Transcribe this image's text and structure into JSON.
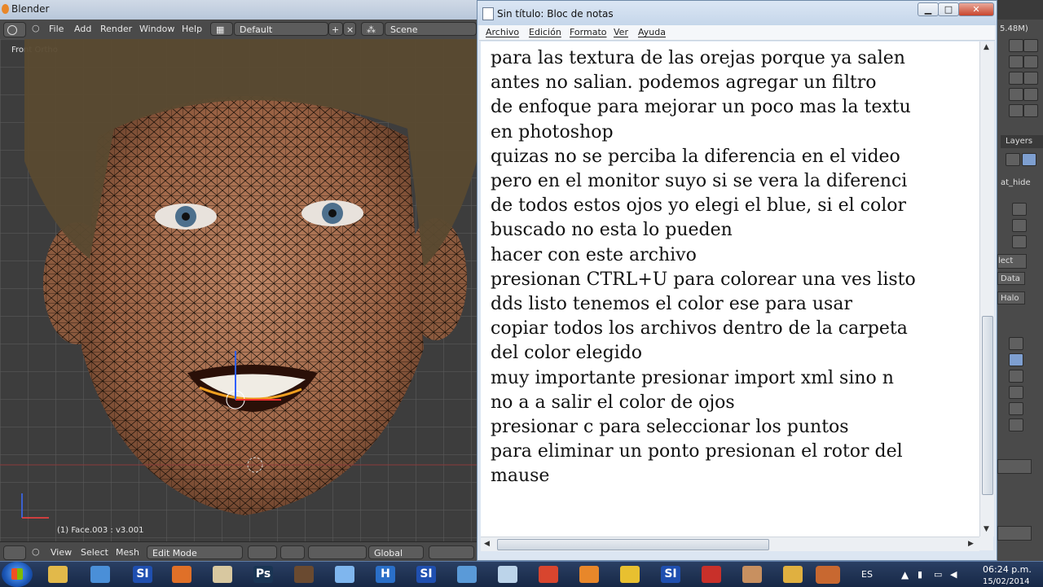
{
  "blender": {
    "title": "Blender",
    "menu": [
      "File",
      "Add",
      "Render",
      "Window",
      "Help"
    ],
    "layout_selector": "Default",
    "scene_selector": "Scene",
    "viewport_label": "Front Ortho",
    "object_info": "(1) Face.003 : v3.001",
    "footer": {
      "view": "View",
      "select": "Select",
      "mesh": "Mesh",
      "mode": "Edit Mode",
      "orientation": "Global"
    },
    "right_panel": {
      "size_readout": "5.48M)",
      "tab_layers": "Layers",
      "field_hide": "at_hide",
      "btn_select": "lect",
      "btn_data": "Data",
      "btn_halo": "Halo"
    }
  },
  "notepad": {
    "title": "Sin título: Bloc de notas",
    "menu": [
      "Archivo",
      "Edición",
      "Formato",
      "Ver",
      "Ayuda"
    ],
    "text": "para las textura de las orejas porque ya salen\nantes no salian. podemos agregar un filtro\nde enfoque para mejorar un poco mas la textu\nen photoshop\nquizas no se perciba la diferencia en el video\npero en el monitor suyo si se vera la diferenci\nde todos estos ojos yo elegi el blue, si el color\nbuscado no esta lo pueden\nhacer con este archivo\npresionan CTRL+U para colorear una ves listo\ndds listo tenemos el color ese para usar\ncopiar todos los archivos dentro de la carpeta\ndel color elegido\nmuy importante presionar import xml sino n\nno a a salir el color de ojos\npresionar c para seleccionar los puntos\npara eliminar un ponto presionan el rotor del\nmause"
  },
  "taskbar": {
    "apps": [
      {
        "name": "explorer",
        "label": "",
        "color": "#e2b94a"
      },
      {
        "name": "paint",
        "label": "",
        "color": "#4a8fd8"
      },
      {
        "name": "si-1",
        "label": "SI",
        "color": "#1f4fb0"
      },
      {
        "name": "avast",
        "label": "",
        "color": "#e07028"
      },
      {
        "name": "tools",
        "label": "",
        "color": "#d8c8a0"
      },
      {
        "name": "photoshop",
        "label": "Ps",
        "color": "#1a3554"
      },
      {
        "name": "game",
        "label": "",
        "color": "#6a4a30"
      },
      {
        "name": "disc",
        "label": "",
        "color": "#7fb6ee"
      },
      {
        "name": "h-app",
        "label": "H",
        "color": "#2a6fc8"
      },
      {
        "name": "si-2",
        "label": "SI",
        "color": "#1f4fb0"
      },
      {
        "name": "app-blue",
        "label": "",
        "color": "#5a9ad8"
      },
      {
        "name": "notepad-app",
        "label": "",
        "color": "#bcd4ea"
      },
      {
        "name": "chrome",
        "label": "",
        "color": "#d8452e"
      },
      {
        "name": "blender-app",
        "label": "",
        "color": "#e8872a"
      },
      {
        "name": "puzzle",
        "label": "",
        "color": "#e8c030"
      },
      {
        "name": "si-3",
        "label": "SI",
        "color": "#1f4fb0"
      },
      {
        "name": "acrobat",
        "label": "",
        "color": "#c8302a"
      },
      {
        "name": "box",
        "label": "",
        "color": "#c89060"
      },
      {
        "name": "mail",
        "label": "",
        "color": "#e0b040"
      },
      {
        "name": "glove",
        "label": "",
        "color": "#c86830"
      }
    ],
    "tray": {
      "language": "ES",
      "time": "06:24 p.m.",
      "date": "15/02/2014"
    }
  }
}
